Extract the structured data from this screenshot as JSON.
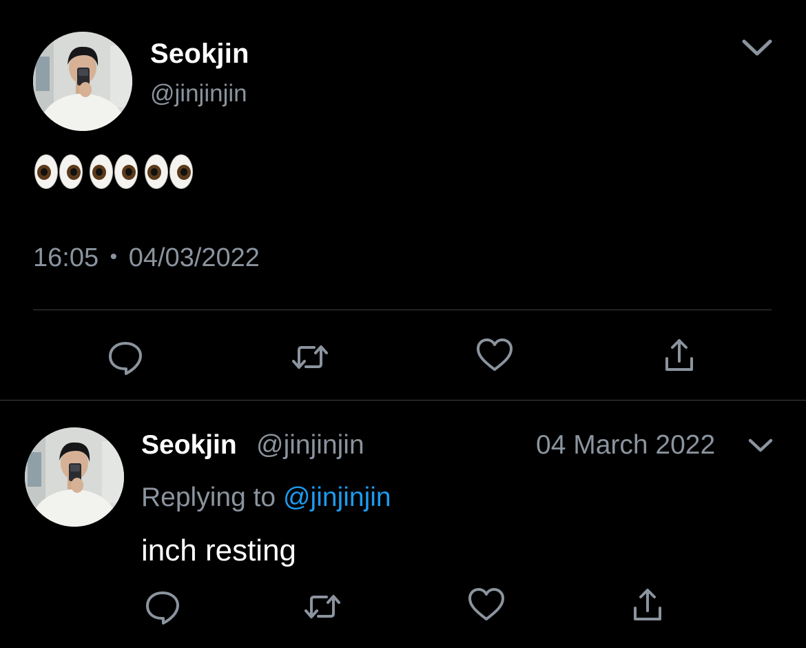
{
  "main_tweet": {
    "display_name": "Seokjin",
    "handle": "@jinjinjin",
    "text_emoji": "👀👀👀",
    "time": "16:05",
    "separator": "•",
    "date": "04/03/2022",
    "actions": [
      "reply-icon",
      "retweet-icon",
      "like-icon",
      "share-icon"
    ]
  },
  "reply_tweet": {
    "display_name": "Seokjin",
    "handle": "@jinjinjin",
    "date": "04 March 2022",
    "replying_to_label": "Replying to",
    "replying_to_handle": "@jinjinjin",
    "text": "inch resting",
    "actions": [
      "reply-icon",
      "retweet-icon",
      "like-icon",
      "share-icon"
    ]
  },
  "colors": {
    "background": "#000000",
    "primary_text": "#ffffff",
    "secondary_text": "#8b949e",
    "link": "#1d9bf0",
    "divider": "#3d4247"
  }
}
